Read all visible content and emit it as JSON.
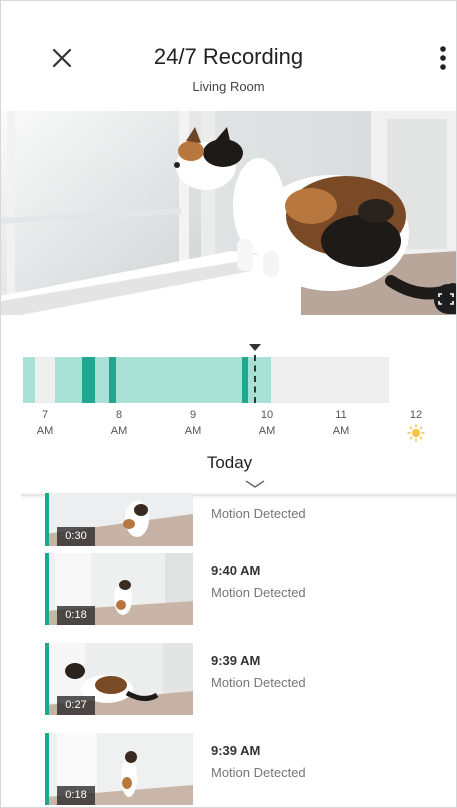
{
  "header": {
    "title": "24/7 Recording",
    "subtitle": "Living Room"
  },
  "timeline": {
    "ticks": [
      {
        "hour": "7",
        "period": "AM"
      },
      {
        "hour": "8",
        "period": "AM"
      },
      {
        "hour": "9",
        "period": "AM"
      },
      {
        "hour": "10",
        "period": "AM"
      },
      {
        "hour": "11",
        "period": "AM"
      },
      {
        "hour": "12",
        "period": ""
      }
    ],
    "day_label": "Today",
    "accent_color": "#1fa88f",
    "recorded_color": "#a8e0d6"
  },
  "clips": [
    {
      "time": "",
      "label": "Motion Detected",
      "duration": "0:30"
    },
    {
      "time": "9:40 AM",
      "label": "Motion Detected",
      "duration": "0:18"
    },
    {
      "time": "9:39 AM",
      "label": "Motion Detected",
      "duration": "0:27"
    },
    {
      "time": "9:39 AM",
      "label": "Motion Detected",
      "duration": "0:18"
    }
  ],
  "icons": {
    "close": "close-icon",
    "more": "more-vertical-icon",
    "fullscreen": "fullscreen-icon",
    "expand": "chevron-down-icon",
    "daytime": "sun-icon"
  }
}
